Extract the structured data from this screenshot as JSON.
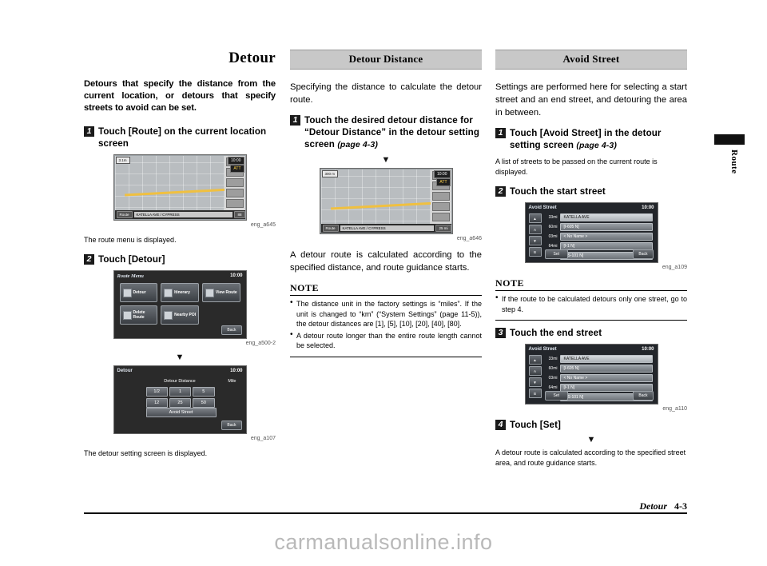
{
  "page": {
    "chapter_tab": "Route",
    "footer_title": "Detour",
    "footer_page": "4-3",
    "watermark": "carmanualsonline.info"
  },
  "col1": {
    "title": "Detour",
    "lead": "Detours that specify the distance from the current location, or detours that specify streets to avoid can be set.",
    "step1": {
      "num": "1",
      "text": "Touch [Route] on the current location screen"
    },
    "caption1": "eng_a645",
    "note1": "The route menu is displayed.",
    "step2": {
      "num": "2",
      "text": "Touch [Detour]"
    },
    "caption2": "eng_a500-2",
    "arrow": "▼",
    "caption3": "eng_a107",
    "note2": "The detour setting screen is displayed.",
    "map": {
      "zoom_label": "3.1m",
      "clock": "10:00",
      "att": "ATT",
      "route_btn": "Route",
      "street": "KATELLA AVE / CYPRESS",
      "btn_right1": "88",
      "btn_right2": "2.9mi\nBack"
    },
    "menu": {
      "title": "Route Menu",
      "clock": "10:00",
      "buttons": [
        "Detour",
        "Itinerary",
        "View Route",
        "Delete Route",
        "Nearby POI"
      ],
      "back": "Back"
    },
    "detour": {
      "title": "Detour",
      "clock": "10:00",
      "label": "Detour Distance",
      "unit": "Mile",
      "values": [
        "1/2",
        "1",
        "5",
        "12",
        "25",
        "50"
      ],
      "avoid": "Avoid Street",
      "back": "Back"
    }
  },
  "col2": {
    "section": "Detour Distance",
    "body": "Specifying the distance to calculate the detour route.",
    "step1": {
      "num": "1",
      "text": "Touch the desired detour distance for “Detour Distance” in the detour setting screen",
      "page": "(page 4-3)"
    },
    "arrow": "▼",
    "caption": "eng_a646",
    "result": "A detour route is calculated according to the specified distance, and route guidance starts.",
    "note_title": "NOTE",
    "notes": [
      "The distance unit in the factory settings is “miles”. If the unit is changed to “km” (“System Settings” (page 11-5)), the detour distances are [1], [5], [10], [20], [40], [80].",
      "A detour route longer than the entire route length cannot be selected."
    ],
    "map": {
      "zoom_label": "300 m",
      "clock": "10:00",
      "att": "ATT",
      "route_btn": "Route",
      "street": "KATELLA AVE / CYPRESS",
      "scale": "25 mi"
    }
  },
  "col3": {
    "section": "Avoid Street",
    "body": "Settings are performed here for selecting a start street and an end street, and detouring the area in between.",
    "step1": {
      "num": "1",
      "text": "Touch [Avoid Street] in the detour setting screen",
      "page": "(page 4-3)"
    },
    "step1_note": "A list of streets to be passed on the current route is displayed.",
    "step2": {
      "num": "2",
      "text": "Touch the start street"
    },
    "caption1": "eng_a109",
    "note_title": "NOTE",
    "note1": "If the route to be calculated detours only one street, go to step 4.",
    "step3": {
      "num": "3",
      "text": "Touch the end street"
    },
    "caption2": "eng_a110",
    "step4": {
      "num": "4",
      "text": "Touch [Set]"
    },
    "arrow": "▼",
    "result": "A detour route is calculated according to the specified street area, and route guidance starts.",
    "avoid_screen": {
      "title": "Avoid Street",
      "clock": "10:00",
      "rows": [
        {
          "dist": "33mi",
          "name": "KATELLA AVE"
        },
        {
          "dist": "60mi",
          "name": "[I-605 N]"
        },
        {
          "dist": "03mi",
          "name": "< No Name >"
        },
        {
          "dist": "64mi",
          "name": "[I-1 N]"
        },
        {
          "dist": "48mi",
          "name": "[US-101 N]"
        }
      ],
      "set": "Set",
      "back": "Back"
    }
  }
}
